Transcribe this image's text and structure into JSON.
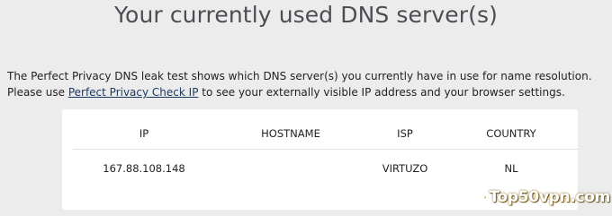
{
  "header": {
    "title": "Your currently used DNS server(s)"
  },
  "description": {
    "text_before": "The Perfect Privacy DNS leak test shows which DNS server(s) you currently have in use for name resolution. Please use ",
    "link_text": "Perfect Privacy Check IP",
    "text_after": " to see your externally visible IP address and your browser settings."
  },
  "table": {
    "columns": [
      "IP",
      "HOSTNAME",
      "ISP",
      "COUNTRY"
    ],
    "rows": [
      [
        "167.88.108.148",
        "",
        "VIRTUZO",
        "NL"
      ]
    ]
  },
  "watermark": {
    "text": "Top50vpn.com",
    "icon": "padlock-icon"
  },
  "colors": {
    "background": "#ececec",
    "title": "#4b4e52",
    "link": "#1b3a63",
    "card": "#ffffff",
    "watermark_gold": "#d9a21e"
  }
}
